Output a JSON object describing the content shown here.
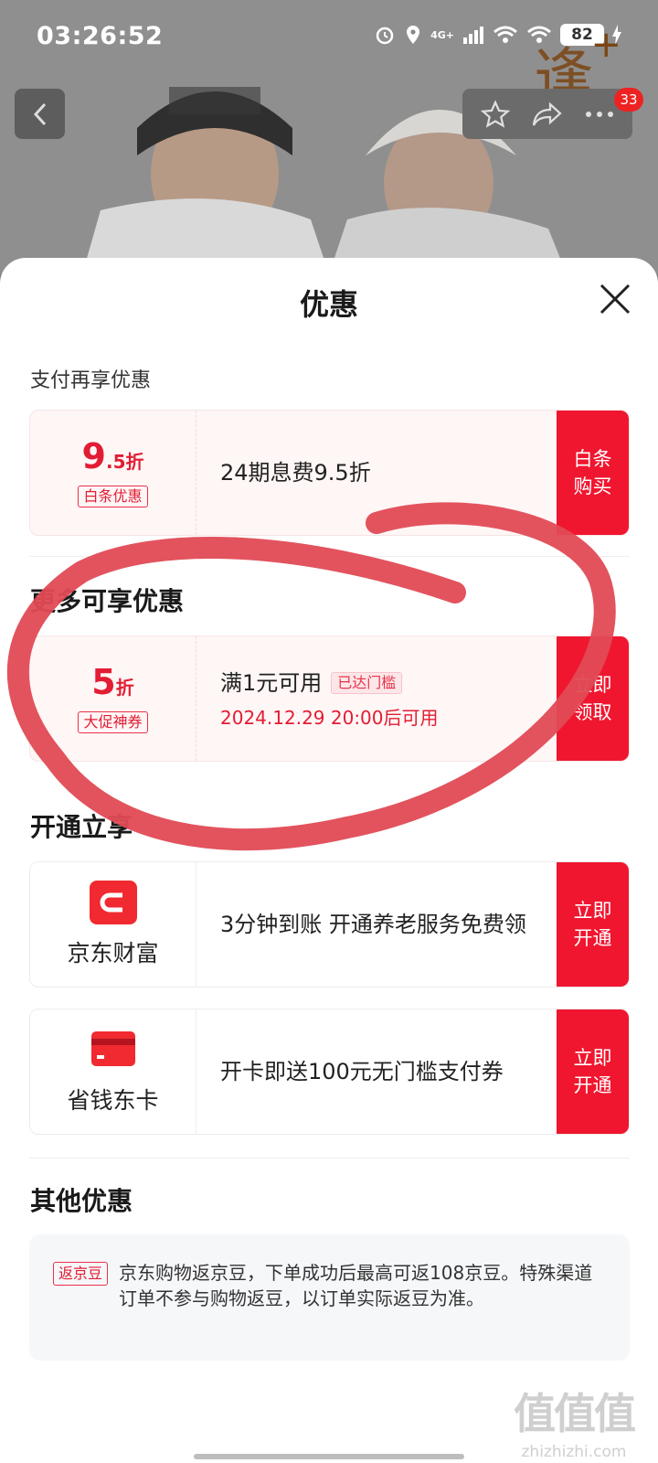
{
  "status_bar": {
    "time": "03:26:52",
    "network": "4G+",
    "battery": "82"
  },
  "header": {
    "cart_count": "33",
    "deco_char": "逢",
    "deco_plus": "+"
  },
  "sheet": {
    "title": "优惠"
  },
  "sections": {
    "payment": "支付再享优惠",
    "more": "更多可享优惠",
    "open": "开通立享",
    "other": "其他优惠"
  },
  "cards": {
    "baitiao": {
      "discount_main": "9",
      "discount_small": ".5折",
      "tag": "白条优惠",
      "text": "24期息费9.5折",
      "cta": "白条购买"
    },
    "coupon": {
      "discount_main": "5",
      "discount_small": "折",
      "tag": "大促神券",
      "text": "满1元可用",
      "pill": "已达门槛",
      "sub": "2024.12.29 20:00后可用",
      "cta": "立即领取"
    },
    "wealth": {
      "name": "京东财富",
      "text": "3分钟到账 开通养老服务免费领",
      "cta": "立即开通"
    },
    "card": {
      "name": "省钱东卡",
      "text": "开卡即送100元无门槛支付券",
      "cta": "立即开通"
    }
  },
  "other": {
    "tag": "返京豆",
    "text": "京东购物返京豆，下单成功后最高可返108京豆。特殊渠道订单不参与购物返豆，以订单实际返豆为准。"
  },
  "watermark": {
    "big": "值值值",
    "small": "zhizhizhi.com"
  },
  "colors": {
    "accent": "#f0162f",
    "accent_text": "#e21d33",
    "scribble": "#e04a55"
  }
}
